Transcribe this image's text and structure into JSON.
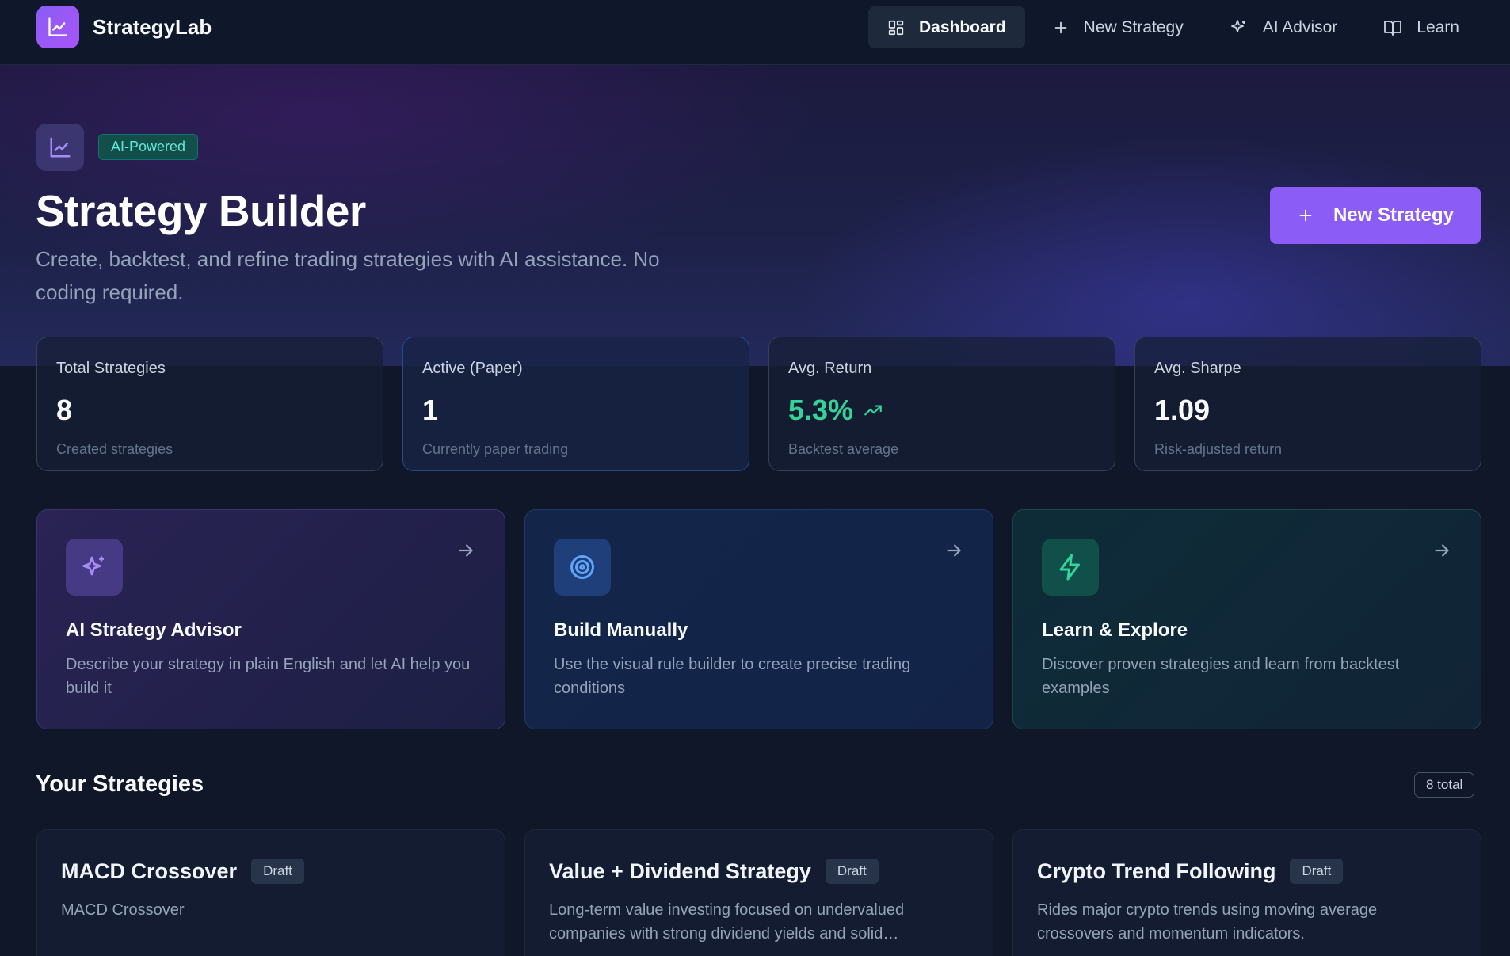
{
  "nav": {
    "brand": "StrategyLab",
    "links": [
      {
        "label": "Dashboard",
        "icon": "grid-icon",
        "active": true
      },
      {
        "label": "New Strategy",
        "icon": "plus-icon",
        "active": false
      },
      {
        "label": "AI Advisor",
        "icon": "sparkles-icon",
        "active": false
      },
      {
        "label": "Learn",
        "icon": "book-icon",
        "active": false
      }
    ]
  },
  "hero": {
    "badge": "AI-Powered",
    "title": "Strategy Builder",
    "subtitle": "Create, backtest, and refine trading strategies with AI assistance. No coding required.",
    "cta": "New Strategy"
  },
  "stats": [
    {
      "label": "Total Strategies",
      "value": "8",
      "caption": "Created strategies"
    },
    {
      "label": "Active (Paper)",
      "value": "1",
      "caption": "Currently paper trading"
    },
    {
      "label": "Avg. Return",
      "value": "5.3%",
      "caption": "Backtest average"
    },
    {
      "label": "Avg. Sharpe",
      "value": "1.09",
      "caption": "Risk-adjusted return"
    }
  ],
  "actions": [
    {
      "title": "AI Strategy Advisor",
      "desc": "Describe your strategy in plain English and let AI help you build it",
      "icon": "sparkles-icon"
    },
    {
      "title": "Build Manually",
      "desc": "Use the visual rule builder to create precise trading conditions",
      "icon": "target-icon"
    },
    {
      "title": "Learn & Explore",
      "desc": "Discover proven strategies and learn from backtest examples",
      "icon": "lightning-icon"
    }
  ],
  "strategies_section": {
    "title": "Your Strategies",
    "count": "8 total"
  },
  "strategies": [
    {
      "name": "MACD Crossover",
      "status": "Draft",
      "desc": "MACD Crossover"
    },
    {
      "name": "Value + Dividend Strategy",
      "status": "Draft",
      "desc": "Long-term value investing focused on undervalued companies with strong dividend yields and solid fundamentals"
    },
    {
      "name": "Crypto Trend Following",
      "status": "Draft",
      "desc": "Rides major crypto trends using moving average crossovers and momentum indicators."
    }
  ],
  "colors": {
    "accent": "#8b5cf6",
    "positive": "#34d399",
    "background": "#0f1729"
  }
}
